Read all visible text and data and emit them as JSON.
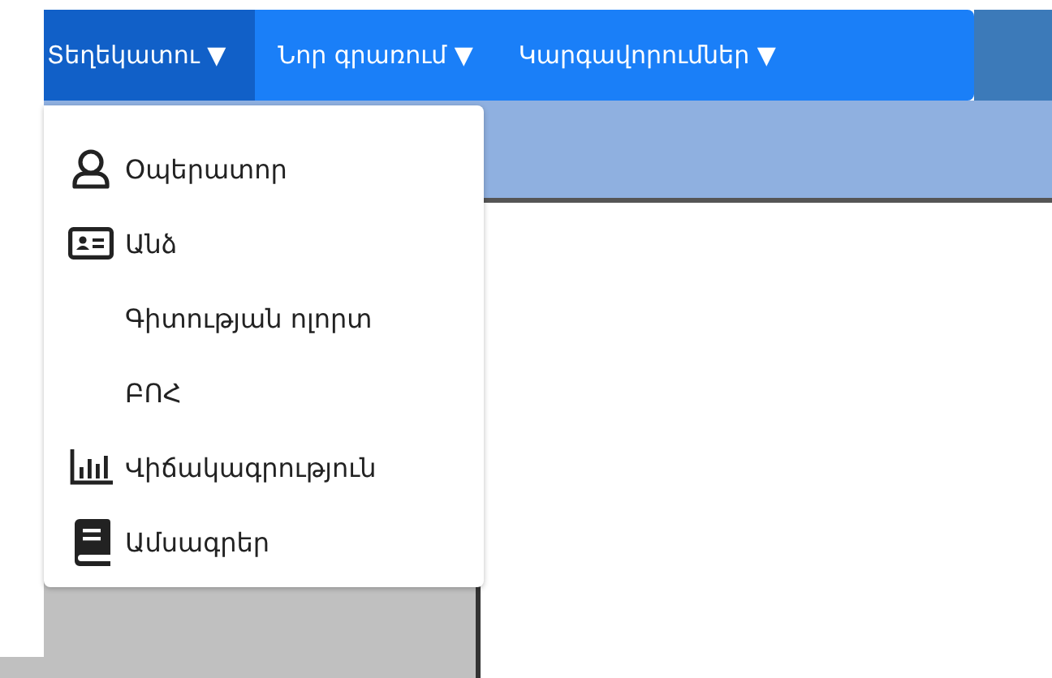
{
  "navbar": {
    "items": [
      {
        "label": "Տեղեկատու",
        "caret": "▼",
        "selected": true
      },
      {
        "label": "Նոր գրառում",
        "caret": "▼",
        "selected": false
      },
      {
        "label": "Կարգավորումներ",
        "caret": "▼",
        "selected": false
      }
    ]
  },
  "dropdown": {
    "items": [
      {
        "label": "Օպերատոր",
        "kind": "user"
      },
      {
        "label": "Անձ",
        "kind": "card"
      },
      {
        "label": "Գիտության ոլորտ",
        "kind": "plain"
      },
      {
        "label": "ԲՈՀ",
        "kind": "plain"
      },
      {
        "label": "Վիճակագրություն",
        "kind": "chart"
      },
      {
        "label": "Ամսագրեր",
        "kind": "book"
      }
    ]
  }
}
